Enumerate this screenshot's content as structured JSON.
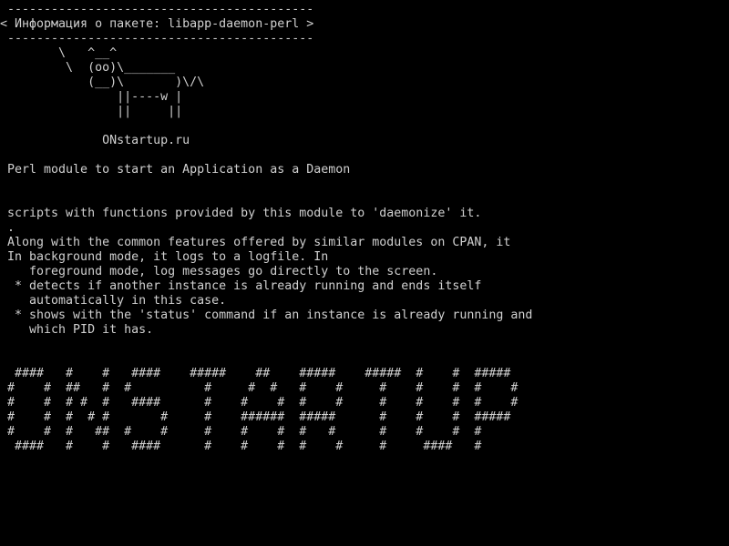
{
  "terminal": {
    "colors": {
      "background": "#000000",
      "foreground": "#d0d0d0"
    },
    "lines": [
      " ------------------------------------------",
      "< Информация о пакете: libapp-daemon-perl >",
      " ------------------------------------------",
      "        \\   ^__^",
      "         \\  (oo)\\_______",
      "            (__)\\       )\\/\\",
      "                ||----w |",
      "                ||     ||",
      "",
      "              ONstartup.ru",
      "",
      " Perl module to start an Application as a Daemon",
      "",
      "",
      " scripts with functions provided by this module to 'daemonize' it.",
      " .",
      " Along with the common features offered by similar modules on CPAN, it",
      " In background mode, it logs to a logfile. In",
      "    foreground mode, log messages go directly to the screen.",
      "  * detects if another instance is already running and ends itself",
      "    automatically in this case.",
      "  * shows with the 'status' command if an instance is already running and",
      "    which PID it has.",
      "",
      "",
      "  ####   #    #   ####    #####    ##    #####    #####  #    #  #####",
      " #    #  ##   #  #          #     #  #   #    #     #    #    #  #    #",
      " #    #  # #  #   ####      #    #    #  #    #     #    #    #  #    #",
      " #    #  #  # #       #     #    ######  #####      #    #    #  #####",
      " #    #  #   ##  #    #     #    #    #  #   #      #    #    #  #",
      "  ####   #    #   ####      #    #    #  #    #     #     ####   #"
    ]
  }
}
